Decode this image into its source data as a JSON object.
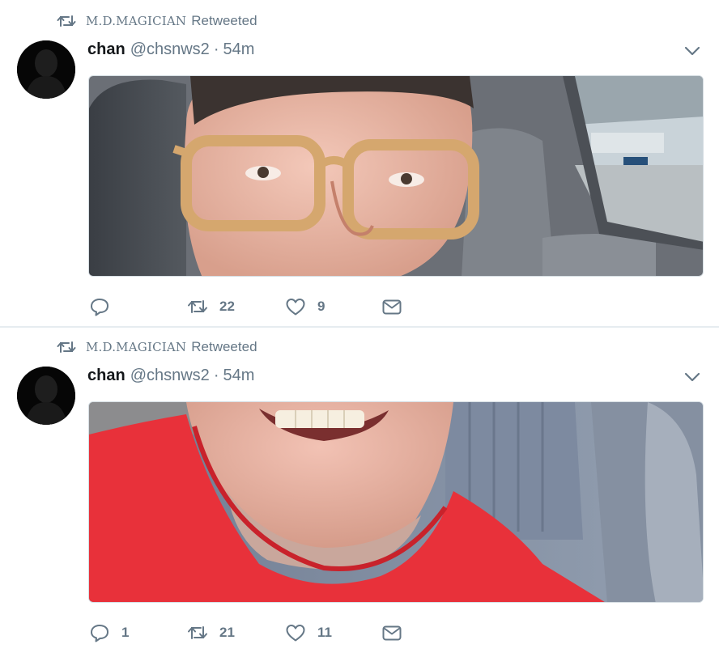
{
  "tweets": [
    {
      "retweeter": "M.D.MAGICIAN",
      "retweet_verb": "Retweeted",
      "author_name": "chan",
      "author_handle": "@chsnws2",
      "separator": "·",
      "timestamp": "54m",
      "actions": {
        "reply_count": "",
        "retweet_count": "22",
        "like_count": "9"
      }
    },
    {
      "retweeter": "M.D.MAGICIAN",
      "retweet_verb": "Retweeted",
      "author_name": "chan",
      "author_handle": "@chsnws2",
      "separator": "·",
      "timestamp": "54m",
      "actions": {
        "reply_count": "1",
        "retweet_count": "21",
        "like_count": "11"
      }
    }
  ],
  "icons": {
    "retweet": "retweet-icon",
    "reply": "reply-icon",
    "like": "heart-icon",
    "dm": "envelope-icon",
    "caret": "chevron-down-icon"
  },
  "colors": {
    "secondary_text": "#657786",
    "primary_text": "#14171a",
    "divider": "#e6ecf0",
    "shirt_red": "#e8313a"
  }
}
